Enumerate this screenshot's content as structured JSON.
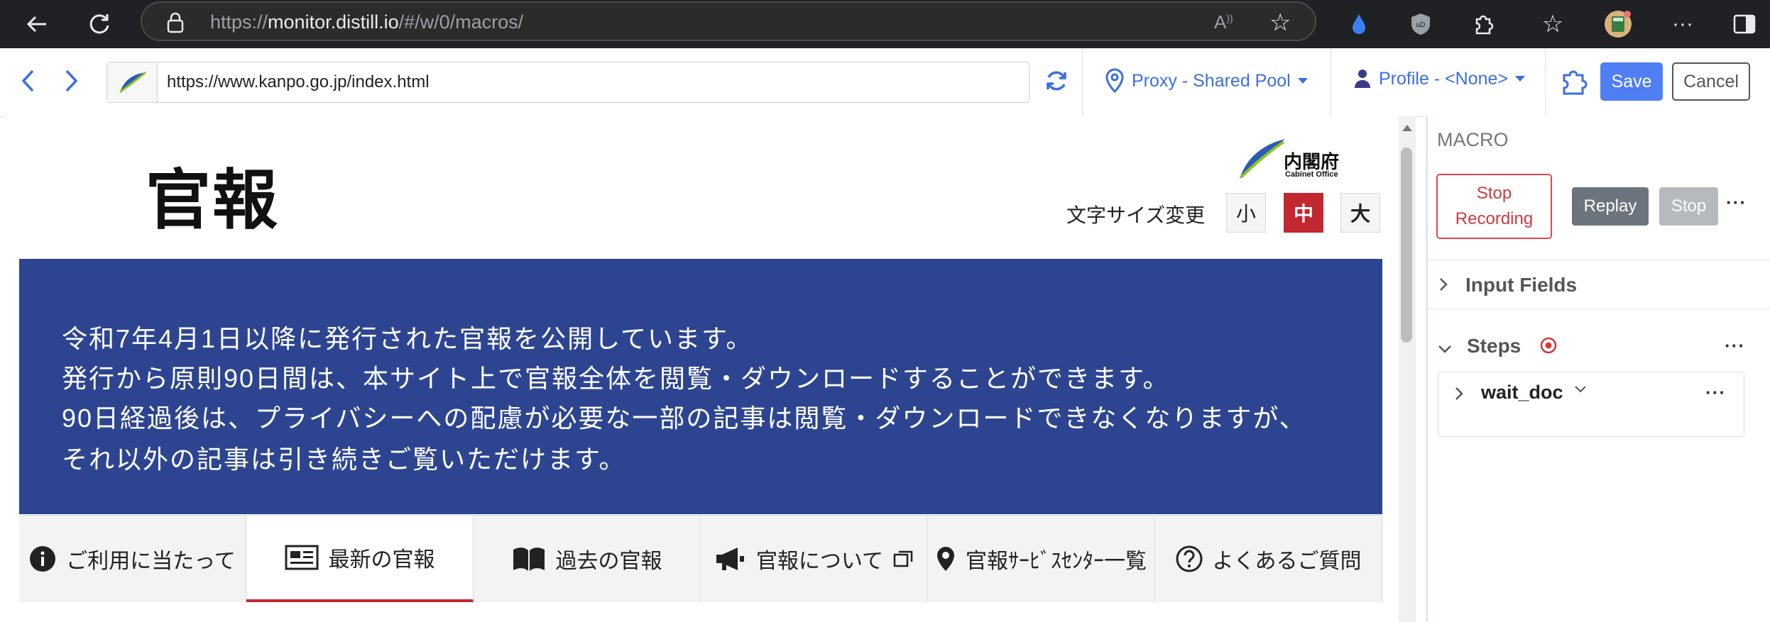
{
  "browser": {
    "url_prefix": "https://",
    "url_host": "monitor.distill.io",
    "url_path": "/#/w/0/macros/",
    "icons": [
      "back-icon",
      "reload-icon",
      "lock-icon",
      "read-aloud-icon",
      "favorite-icon",
      "drop-extension-icon",
      "ublock-icon",
      "extensions-icon",
      "favorites-icon",
      "calculator-extension-icon",
      "more-icon",
      "sidebar-icon"
    ]
  },
  "toolbar": {
    "frame_url": "https://www.kanpo.go.jp/index.html",
    "proxy_label": "Proxy - Shared Pool",
    "profile_label": "Profile - <None>",
    "save_label": "Save",
    "cancel_label": "Cancel"
  },
  "site": {
    "logo_text": "官報",
    "cabinet_text": "内閣府",
    "cabinet_sub": "Cabinet Office",
    "font_size_label": "文字サイズ変更",
    "font_size_small": "小",
    "font_size_medium": "中",
    "font_size_large": "大",
    "banner_lines": [
      "令和7年4月1日以降に発行された官報を公開しています。",
      "発行から原則90日間は、本サイト上で官報全体を閲覧・ダウンロードすることができます。",
      "90日経過後は、プライバシーへの配慮が必要な一部の記事は閲覧・ダウンロードできなくなりますが、",
      "それ以外の記事は引き続きご覧いただけます。"
    ],
    "nav": [
      {
        "label": "ご利用に当たって",
        "icon": "info-icon"
      },
      {
        "label": "最新の官報",
        "icon": "newspaper-icon"
      },
      {
        "label": "過去の官報",
        "icon": "book-icon"
      },
      {
        "label": "官報について",
        "icon": "megaphone-icon"
      },
      {
        "label": "官報ｻｰﾋﾞｽｾﾝﾀｰ一覧",
        "icon": "map-pin-icon"
      },
      {
        "label": "よくあるご質問",
        "icon": "question-icon"
      }
    ]
  },
  "macro": {
    "title": "MACRO",
    "stop_recording_line1": "Stop",
    "stop_recording_line2": "Recording",
    "replay_label": "Replay",
    "stop_label": "Stop",
    "input_fields_label": "Input Fields",
    "steps_label": "Steps",
    "step_name": "wait_doc"
  },
  "colors": {
    "accent": "#4f7ef5",
    "banner": "#2d4591",
    "active_red": "#c3272f"
  }
}
